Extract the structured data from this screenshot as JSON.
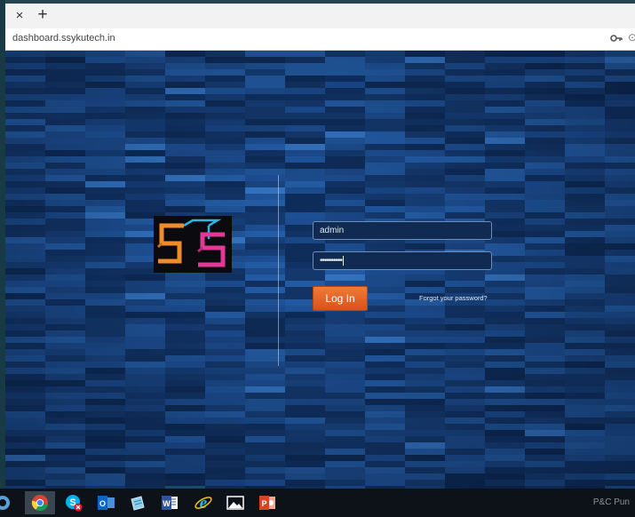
{
  "browser": {
    "tab_close_glyph": "×",
    "new_tab_glyph": "+",
    "url": "dashboard.ssykutech.in",
    "more_glyph": "⊙"
  },
  "login": {
    "username_value": "admin",
    "password_mask": "••••••••••",
    "login_button_label": "Log In",
    "forgot_password_link": "Forgot your password?",
    "accent_color": "#e0621f"
  },
  "logo": {
    "letters": "SS",
    "colors": [
      "#f08c2a",
      "#e03a96",
      "#2bb6e8"
    ]
  },
  "taskbar": {
    "items": [
      {
        "icon": "partial-app-icon"
      },
      {
        "icon": "chrome-icon",
        "active": true
      },
      {
        "icon": "skype-icon"
      },
      {
        "icon": "outlook-icon"
      },
      {
        "icon": "notepad-icon"
      },
      {
        "icon": "word-icon"
      },
      {
        "icon": "internet-explorer-icon"
      },
      {
        "icon": "photos-icon"
      },
      {
        "icon": "powerpoint-icon"
      }
    ],
    "watermark": "P&C Pun"
  }
}
